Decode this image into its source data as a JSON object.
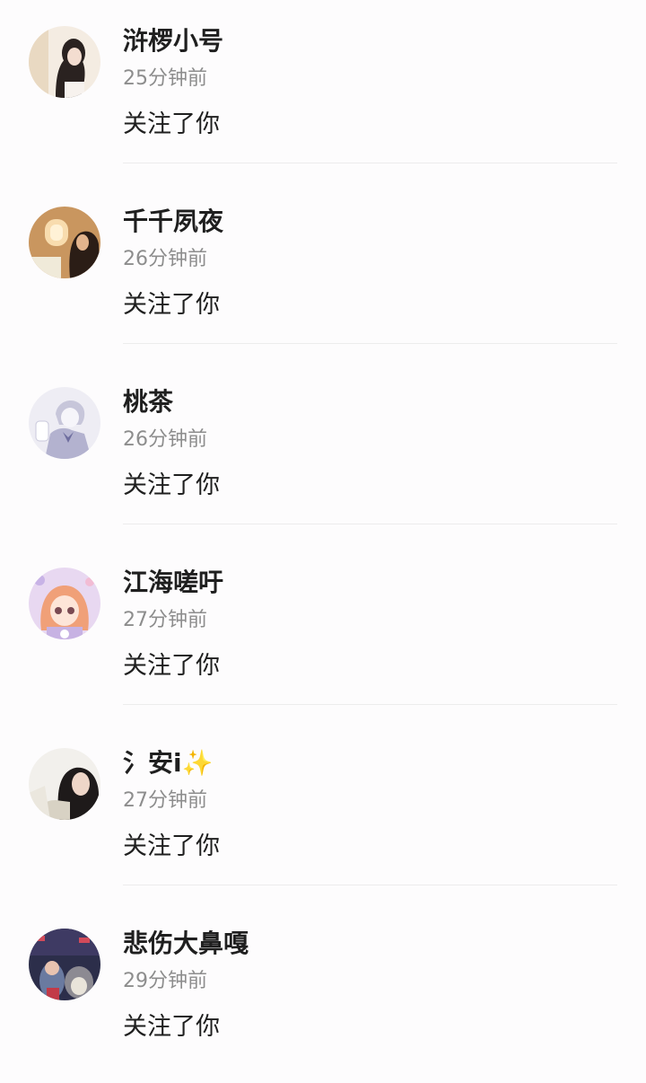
{
  "notifications": [
    {
      "name": "浒椤小号",
      "time": "25分钟前",
      "action": "关注了你"
    },
    {
      "name": "千千夙夜",
      "time": "26分钟前",
      "action": "关注了你"
    },
    {
      "name": "桃茶",
      "time": "26分钟前",
      "action": "关注了你"
    },
    {
      "name": "江海嗟吁",
      "time": "27分钟前",
      "action": "关注了你"
    },
    {
      "name": "氵安i✨",
      "time": "27分钟前",
      "action": "关注了你"
    },
    {
      "name": "悲伤大鼻嘎",
      "time": "29分钟前",
      "action": "关注了你"
    }
  ],
  "colors": {
    "background": "#fdfcfd",
    "name_text": "#1f1f1f",
    "time_text": "#8d8d8d",
    "divider": "#ececec"
  }
}
